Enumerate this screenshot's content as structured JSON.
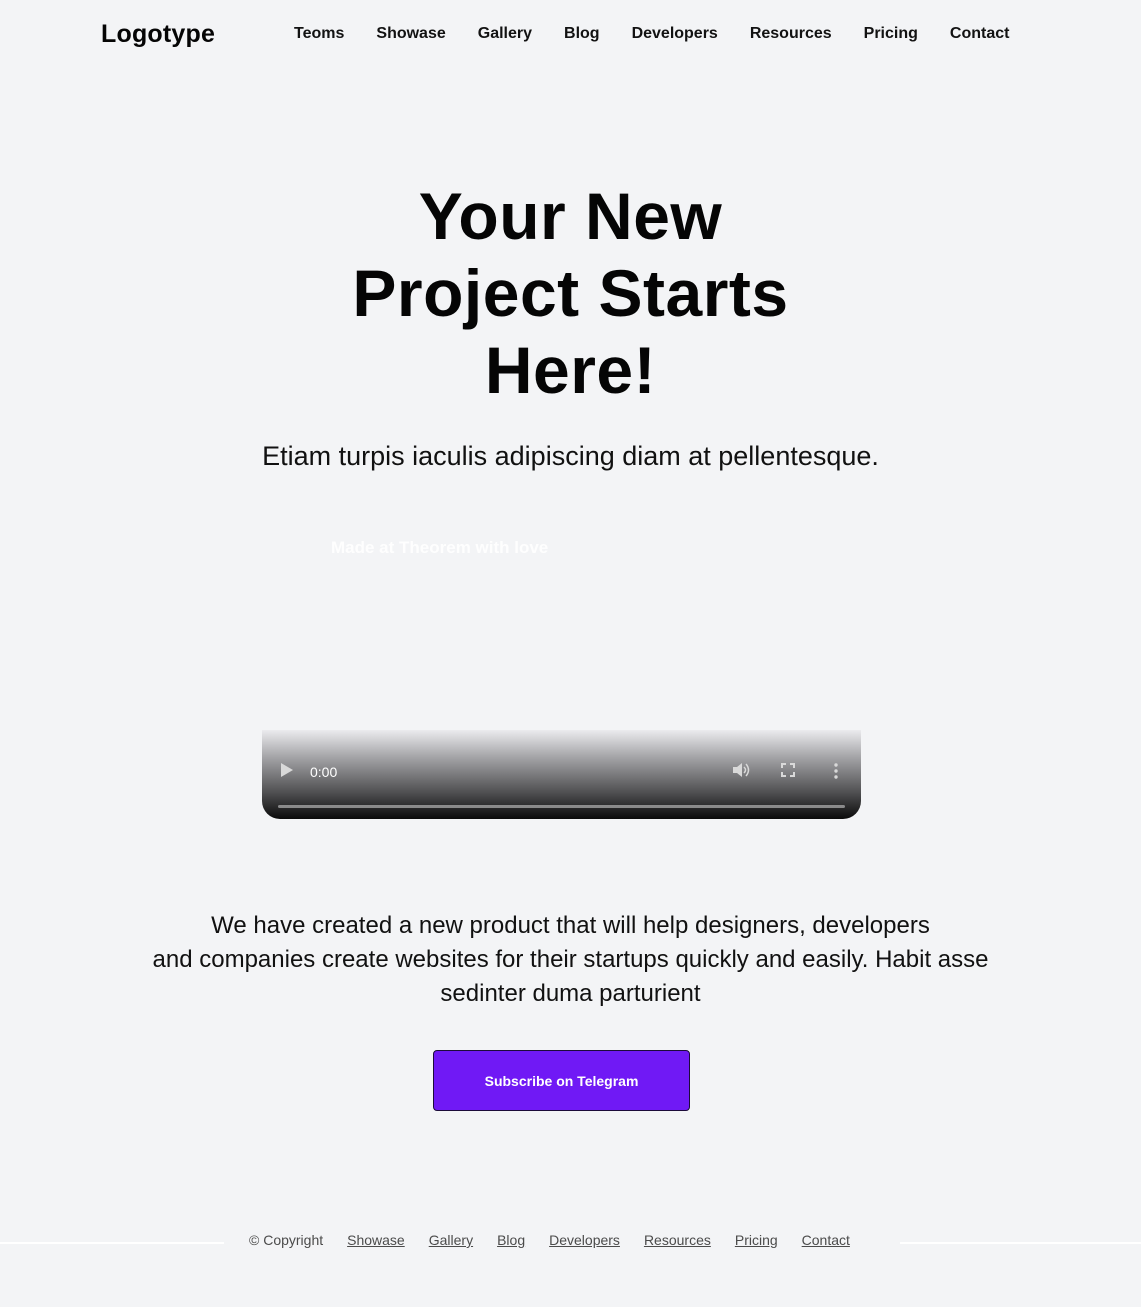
{
  "header": {
    "logo": "Logotype",
    "nav": [
      "Teoms",
      "Showase",
      "Gallery",
      "Blog",
      "Developers",
      "Resources",
      "Pricing",
      "Contact"
    ]
  },
  "hero": {
    "title_lines": [
      "Your New",
      "Project Starts",
      "Here!"
    ],
    "subtitle": "Etiam turpis iaculis adipiscing diam at pellentesque."
  },
  "video": {
    "overlay_text": "Made at Theorem with love",
    "time": "0:00",
    "progress": 0,
    "icons": [
      "play-icon",
      "volume-icon",
      "fullscreen-icon",
      "more-options-icon"
    ]
  },
  "description": {
    "lines": [
      "We have created a new product that will help designers, developers",
      "and companies create websites for their startups quickly and easily. Habit asse",
      "sedinter duma parturient"
    ]
  },
  "cta": {
    "label": "Subscribe on Telegram",
    "color": "#7019f5"
  },
  "footer": {
    "copyright": "© Copyright",
    "links": [
      "Showase",
      "Gallery",
      "Blog",
      "Developers",
      "Resources",
      "Pricing",
      "Contact"
    ]
  }
}
